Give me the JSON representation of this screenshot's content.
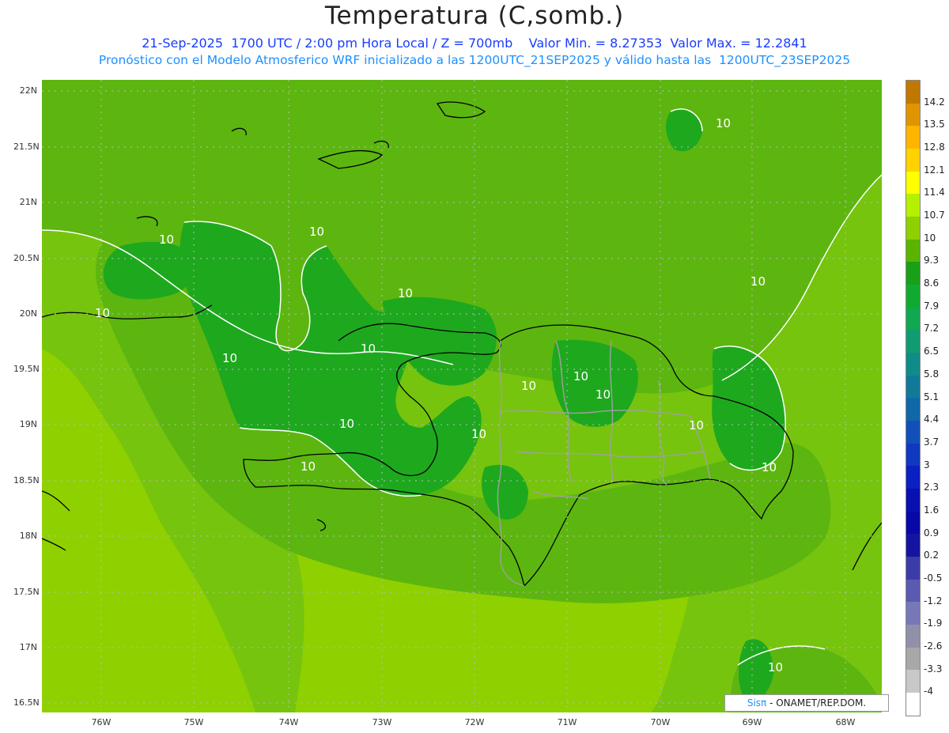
{
  "header": {
    "title": "Temperatura (C,somb.)",
    "line1": "21-Sep-2025  1700 UTC / 2:00 pm Hora Local / Z = 700mb    Valor Min. = 8.27353  Valor Max. = 12.2841",
    "line2": "Pronóstico con el Modelo Atmosferico WRF inicializado a las 1200UTC_21SEP2025 y válido hasta las  1200UTC_23SEP2025"
  },
  "map": {
    "lat_labels": [
      "22N",
      "21.5N",
      "21N",
      "20.5N",
      "20N",
      "19.5N",
      "19N",
      "18.5N",
      "18N",
      "17.5N",
      "17N",
      "16.5N"
    ],
    "lon_labels": [
      "76W",
      "75W",
      "74W",
      "73W",
      "72W",
      "71W",
      "70W",
      "69W",
      "68W"
    ],
    "contour_label": "10",
    "colors": {
      "fill_9_3": "#1ea81e",
      "fill_10": "#4fb81a",
      "fill_10_7": "#76c40e",
      "fill_11_4": "#98d400",
      "coast": "#000000",
      "border": "#a0a0a0",
      "contour": "#ffffff"
    }
  },
  "colorbar": {
    "labels": [
      "14.2",
      "13.5",
      "12.8",
      "12.1",
      "11.4",
      "10.7",
      "10",
      "9.3",
      "8.6",
      "7.9",
      "7.2",
      "6.5",
      "5.8",
      "5.1",
      "4.4",
      "3.7",
      "3",
      "2.3",
      "1.6",
      "0.9",
      "0.2",
      "-0.5",
      "-1.2",
      "-1.9",
      "-2.6",
      "-3.3",
      "-4"
    ],
    "colors": [
      "#c07800",
      "#e09400",
      "#ffb400",
      "#ffd200",
      "#ffff00",
      "#b4f000",
      "#8ed000",
      "#5ab400",
      "#18a018",
      "#10aa30",
      "#10a850",
      "#109c70",
      "#108c88",
      "#107a98",
      "#1068a8",
      "#1050b8",
      "#1038c0",
      "#0a20c0",
      "#0810b0",
      "#0808a8",
      "#1414a0",
      "#3c3ca8",
      "#5a5ab0",
      "#7878b8",
      "#9090a8",
      "#a8a8a8",
      "#c8c8c8",
      "#ffffff"
    ]
  },
  "credit": {
    "sis": "Sisπ",
    "rest": " - ONAMET/REP.DOM."
  }
}
